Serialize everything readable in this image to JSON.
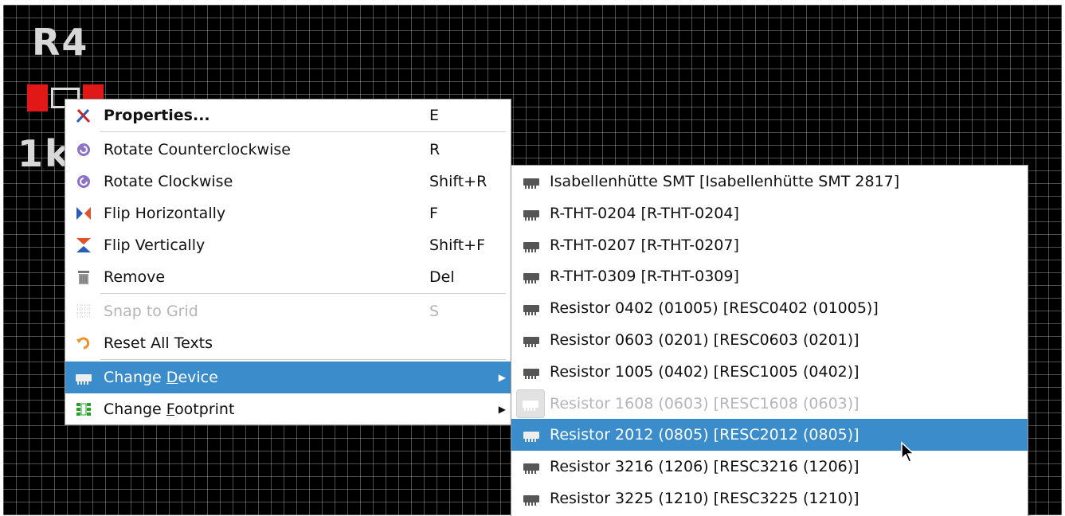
{
  "canvas": {
    "name_text": "R4",
    "value_text": "1k"
  },
  "context_menu": {
    "items": [
      {
        "label": "Properties...",
        "shortcut": "E",
        "icon": "properties-icon"
      },
      {
        "label": "Rotate Counterclockwise",
        "shortcut": "R",
        "icon": "rotate-ccw-icon"
      },
      {
        "label": "Rotate Clockwise",
        "shortcut": "Shift+R",
        "icon": "rotate-cw-icon"
      },
      {
        "label": "Flip Horizontally",
        "shortcut": "F",
        "icon": "flip-horizontal-icon"
      },
      {
        "label": "Flip Vertically",
        "shortcut": "Shift+F",
        "icon": "flip-vertical-icon"
      },
      {
        "label": "Remove",
        "shortcut": "Del",
        "icon": "trash-icon"
      },
      {
        "label": "Snap to Grid",
        "shortcut": "S",
        "icon": "grid-icon",
        "disabled": true
      },
      {
        "label": "Reset All Texts",
        "shortcut": "",
        "icon": "reset-icon"
      },
      {
        "label": "Change Device",
        "mnemonic": "D",
        "icon": "device-icon",
        "submenu": true,
        "selected": true
      },
      {
        "label": "Change Footprint",
        "mnemonic": "F",
        "icon": "footprint-icon",
        "submenu": true
      }
    ]
  },
  "device_submenu": {
    "items": [
      {
        "label": "Isabellenhütte SMT [Isabellenhütte SMT 2817]"
      },
      {
        "label": "R-THT-0204 [R-THT-0204]"
      },
      {
        "label": "R-THT-0207 [R-THT-0207]"
      },
      {
        "label": "R-THT-0309 [R-THT-0309]"
      },
      {
        "label": "Resistor 0402 (01005) [RESC0402 (01005)]"
      },
      {
        "label": "Resistor 0603 (0201) [RESC0603 (0201)]"
      },
      {
        "label": "Resistor 1005 (0402) [RESC1005 (0402)]"
      },
      {
        "label": "Resistor 1608 (0603) [RESC1608 (0603)]",
        "disabled": true,
        "current": true
      },
      {
        "label": "Resistor 2012 (0805) [RESC2012 (0805)]",
        "selected": true
      },
      {
        "label": "Resistor 3216 (1206) [RESC3216 (1206)]"
      },
      {
        "label": "Resistor 3225 (1210) [RESC3225 (1210)]"
      }
    ]
  },
  "colors": {
    "selection": "#3b8ccb",
    "canvas_background": "#000000",
    "pad": "#e01818"
  }
}
